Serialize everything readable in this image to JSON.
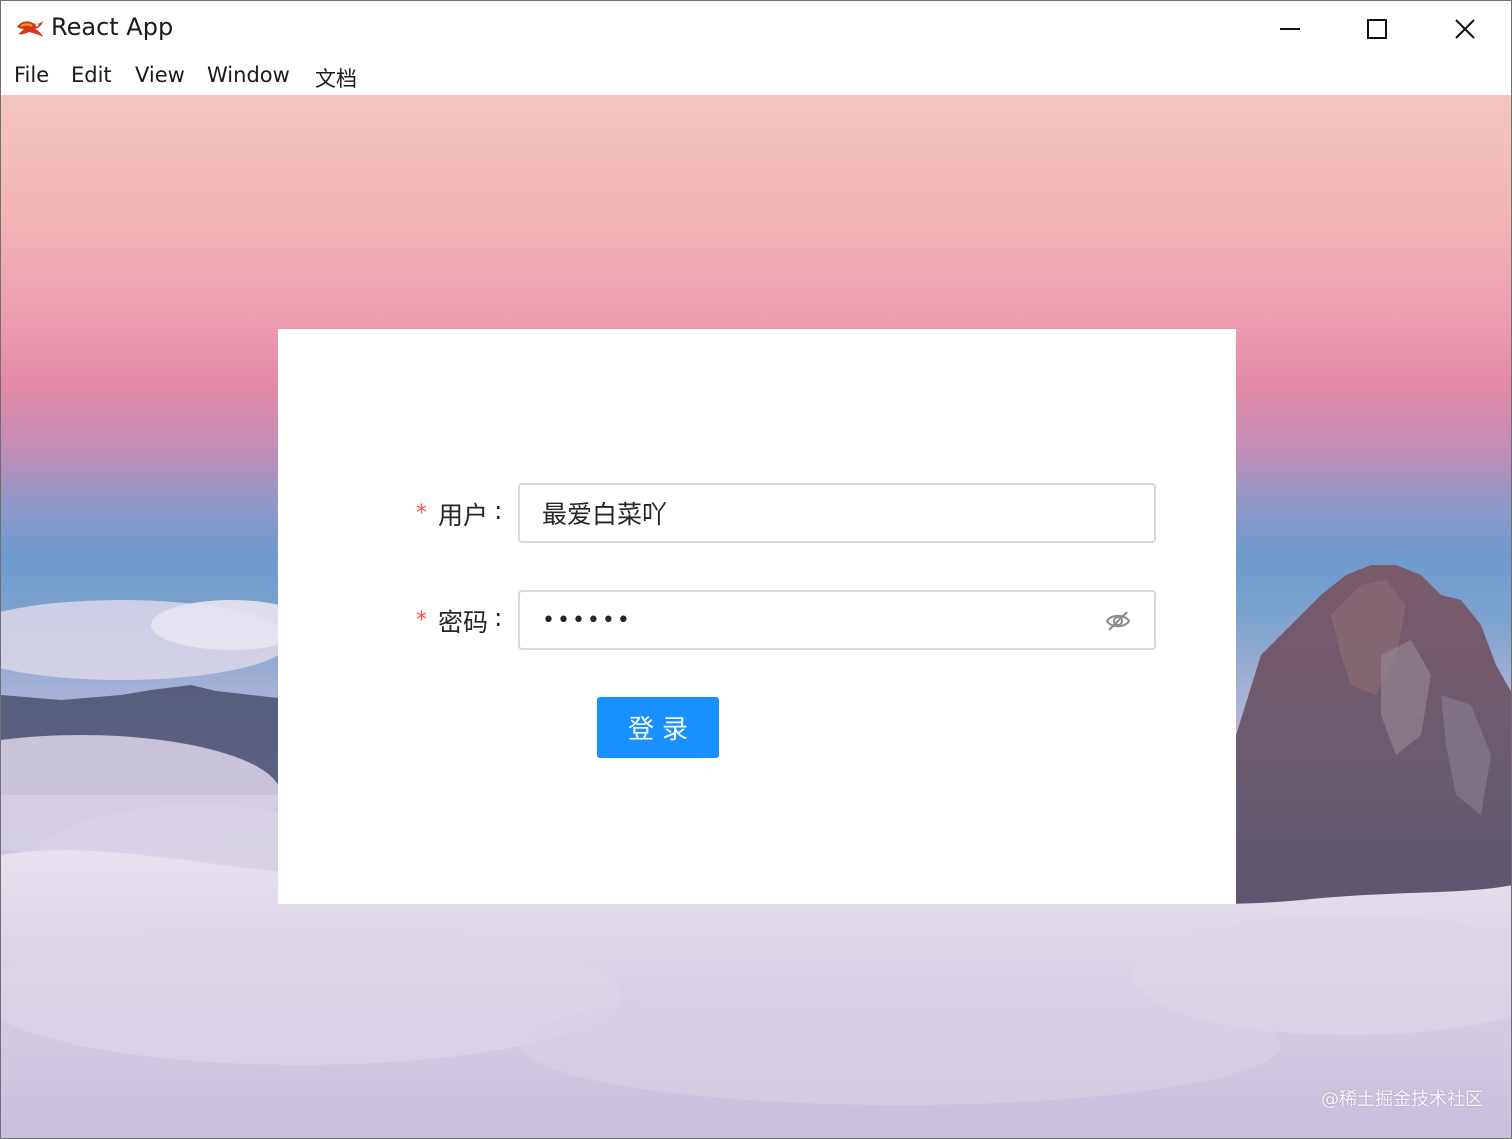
{
  "window": {
    "title": "React App",
    "controls": {
      "minimize": "minimize-icon",
      "maximize": "maximize-icon",
      "close": "close-icon"
    }
  },
  "menu": {
    "items": [
      "File",
      "Edit",
      "View",
      "Window",
      "文档"
    ]
  },
  "login_form": {
    "username_label": "用户",
    "username_value": "最爱白菜吖",
    "password_label": "密码",
    "password_value": "••••••",
    "colon": ":",
    "required_marker": "*",
    "submit_label": "登录",
    "visibility_icon": "eye-invisible-icon"
  },
  "watermark": "@稀土掘金技术社区",
  "colors": {
    "primary": "#1890ff",
    "required": "#ff4d4f",
    "input_border": "#d9d9d9"
  }
}
